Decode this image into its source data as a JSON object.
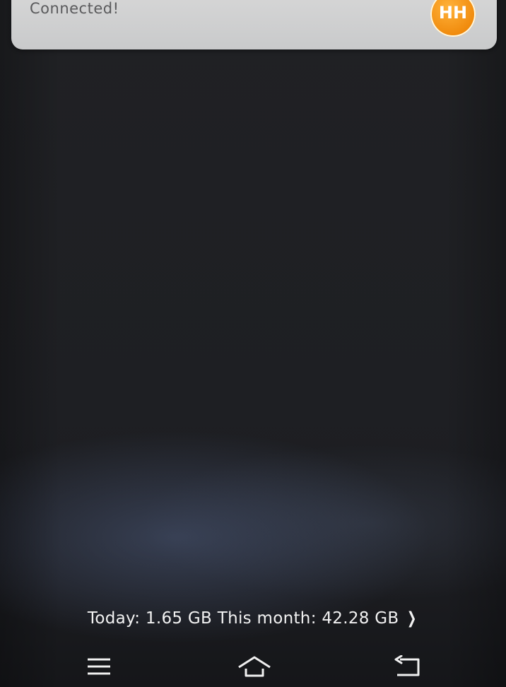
{
  "notification": {
    "text": "Connected!",
    "badge_label": "HH",
    "badge_color": "#f08a0c"
  },
  "data_usage": {
    "text": "Today: 1.65 GB This month: 42.28 GB",
    "chevron": "❯"
  },
  "nav_bar": {
    "items": [
      {
        "icon": "menu-icon"
      },
      {
        "icon": "home-icon"
      },
      {
        "icon": "back-icon"
      }
    ]
  }
}
